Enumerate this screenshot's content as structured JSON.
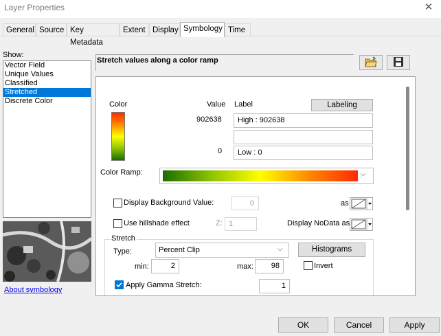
{
  "window": {
    "title": "Layer Properties",
    "close_glyph": "✕"
  },
  "tabs": [
    {
      "label": "General"
    },
    {
      "label": "Source"
    },
    {
      "label": "Key Metadata"
    },
    {
      "label": "Extent"
    },
    {
      "label": "Display"
    },
    {
      "label": "Symbology"
    },
    {
      "label": "Time"
    }
  ],
  "active_tab": "Symbology",
  "show": {
    "label": "Show:",
    "items": [
      {
        "label": "Vector Field"
      },
      {
        "label": "Unique Values"
      },
      {
        "label": "Classified"
      },
      {
        "label": "Stretched"
      },
      {
        "label": "Discrete Color"
      }
    ],
    "selected": "Stretched",
    "about_link": "About symbology"
  },
  "renderer": {
    "title": "Stretch values along a color ramp",
    "headers": {
      "color": "Color",
      "value": "Value",
      "label": "Label"
    },
    "labeling_button": "Labeling",
    "high_value": "902638",
    "high_label": "High : 902638",
    "mid_label": "",
    "low_value": "0",
    "low_label": "Low : 0",
    "color_ramp_label": "Color Ramp:",
    "ramp_colors": [
      "#1a6d00",
      "#8fc400",
      "#ffff00",
      "#ff8800",
      "#ff2a00"
    ],
    "display_background": {
      "label": "Display Background Value:",
      "value": "0",
      "as_label": "as",
      "checked": false
    },
    "hillshade": {
      "label": "Use hillshade effect",
      "z_label": "Z:",
      "z_value": "1",
      "checked": false
    },
    "nodata_label": "Display NoData as",
    "stretch": {
      "group_label": "Stretch",
      "type_label": "Type:",
      "type_value": "Percent Clip",
      "histograms_button": "Histograms",
      "min_label": "min:",
      "min_value": "2",
      "max_label": "max:",
      "max_value": "98",
      "invert_label": "Invert",
      "invert_checked": false,
      "gamma_label": "Apply Gamma Stretch:",
      "gamma_checked": true,
      "gamma_value": "1"
    }
  },
  "icons": {
    "open": "open-folder-icon",
    "save": "save-disk-icon"
  },
  "buttons": {
    "ok": "OK",
    "cancel": "Cancel",
    "apply": "Apply"
  }
}
